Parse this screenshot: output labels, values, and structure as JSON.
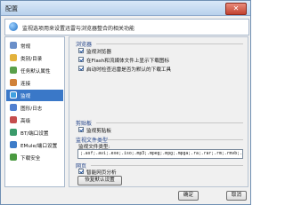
{
  "window": {
    "title": "配置",
    "close_glyph": "✕"
  },
  "header": {
    "text": "监视选项用来设置迅雷与浏览器整合的相关功能"
  },
  "sidebar": {
    "items": [
      {
        "label": "常规",
        "icon": "gear-icon",
        "color": "#6a8fc9"
      },
      {
        "label": "类别/目录",
        "icon": "folder-icon",
        "color": "#e3b23c"
      },
      {
        "label": "任务默认属性",
        "icon": "task-icon",
        "color": "#5aa04a"
      },
      {
        "label": "连接",
        "icon": "connection-icon",
        "color": "#d0823a"
      },
      {
        "label": "监视",
        "icon": "monitor-icon",
        "color": "#3fa0e0"
      },
      {
        "label": "图形/日志",
        "icon": "graph-icon",
        "color": "#4f7fd0"
      },
      {
        "label": "高级",
        "icon": "advanced-icon",
        "color": "#c54d4d"
      },
      {
        "label": "BT/端口设置",
        "icon": "bt-icon",
        "color": "#3a9a6a"
      },
      {
        "label": "EMule/端口设置",
        "icon": "emule-icon",
        "color": "#3d7cc9"
      },
      {
        "label": "下载安全",
        "icon": "shield-icon",
        "color": "#4a9a40"
      }
    ],
    "active_index": 4
  },
  "panel": {
    "browser": {
      "title": "浏览器",
      "options": [
        {
          "label": "监视浏览器",
          "checked": true
        },
        {
          "label": "在Flash和流媒体文件上显示下载图标",
          "checked": true
        },
        {
          "label": "启动时检查迅雷是否为默认的下载工具",
          "checked": true
        }
      ]
    },
    "clipboard": {
      "title": "剪贴板",
      "options": [
        {
          "label": "监视剪贴板",
          "checked": true
        }
      ]
    },
    "filetypes": {
      "title": "监视文件类型",
      "field_label": "监视文件类型:",
      "value": ";.asf;.avi;.exe;.iso;.mp3;.mpeg;.mpg;.mpga;.ra;.rar;.rm;.rmvb;.tar;.wma;.wmp"
    },
    "web": {
      "title": "网页",
      "options": [
        {
          "label": "智能网页分析",
          "checked": true
        }
      ]
    },
    "restore_button": "恢复默认设置"
  },
  "footer": {
    "ok": "确定",
    "cancel": "取消"
  }
}
